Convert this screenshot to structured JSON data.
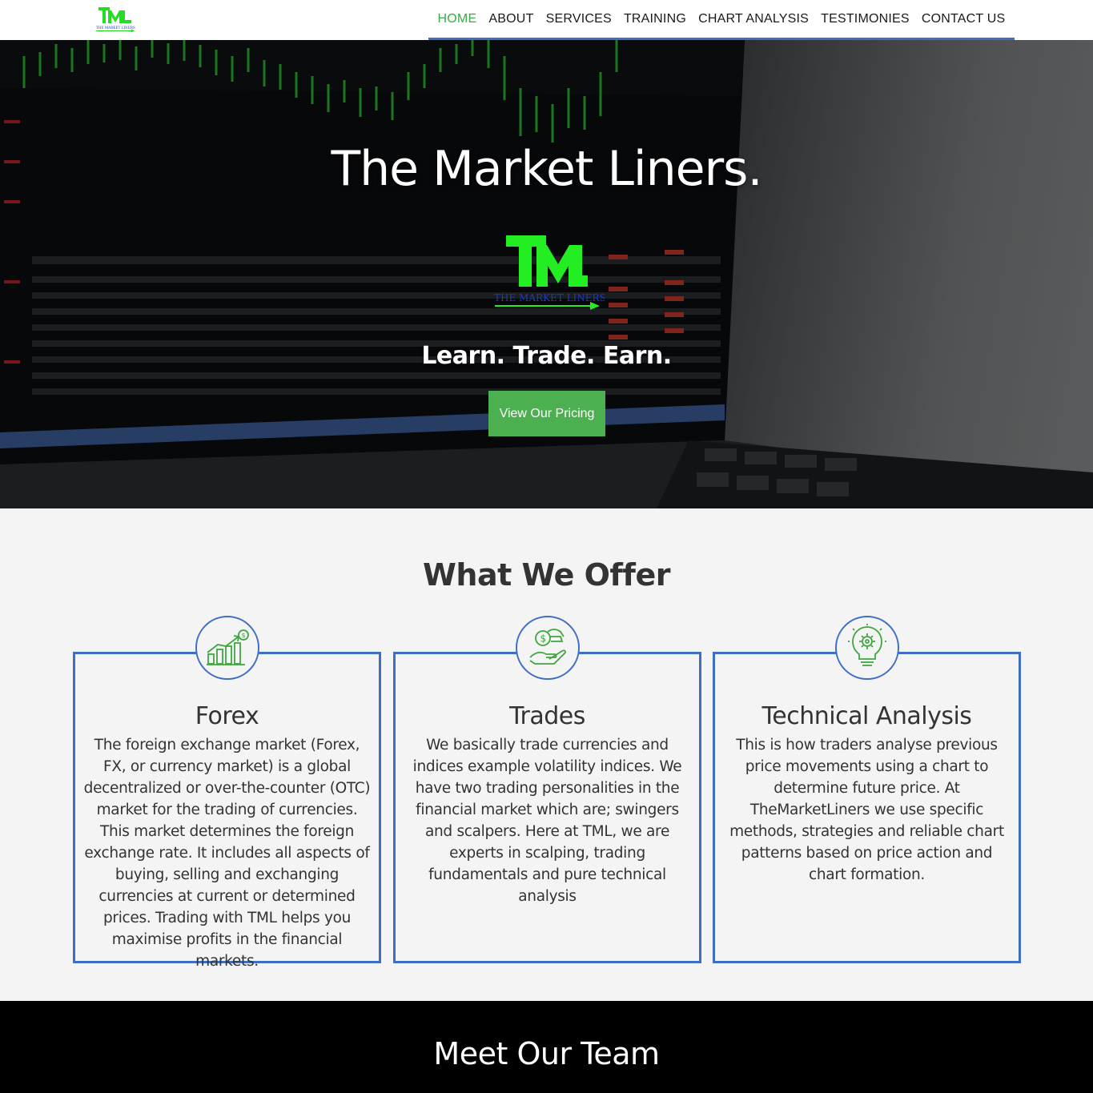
{
  "header": {
    "brand_logo_text": "TML",
    "brand_logo_subtext": "THE MARKET LINERS",
    "nav": [
      {
        "label": "HOME",
        "active": true
      },
      {
        "label": "ABOUT"
      },
      {
        "label": "SERVICES"
      },
      {
        "label": "TRAINING"
      },
      {
        "label": "CHART ANALYSIS"
      },
      {
        "label": "TESTIMONIES"
      },
      {
        "label": "CONTACT US"
      }
    ]
  },
  "hero": {
    "title": "The Market Liners.",
    "logo_text": "TML",
    "logo_subtext": "THE MARKET LINERS",
    "tagline": "Learn. Trade. Earn.",
    "cta_label": "View Our Pricing"
  },
  "offer": {
    "title": "What We Offer",
    "cards": [
      {
        "icon": "growth-chart-icon",
        "title": "Forex",
        "text": "The foreign exchange market (Forex, FX, or currency market) is a global decentralized or over-the-counter (OTC) market for the trading of currencies. This market determines the foreign exchange rate. It includes all aspects of buying, selling and exchanging currencies at current or determined prices. Trading with TML helps you maximise profits in the financial markets."
      },
      {
        "icon": "hand-money-icon",
        "title": "Trades",
        "text": "We basically trade currencies and indices example volatility indices. We have two trading personalities in the financial market which are; swingers and scalpers. Here at TML, we are experts in scalping, trading fundamentals and pure technical analysis"
      },
      {
        "icon": "lightbulb-gear-icon",
        "title": "Technical Analysis",
        "text": "This is how traders analyse previous price movements using a chart to determine future price. At TheMarketLiners we use specific methods, strategies and reliable chart patterns based on price action and chart formation."
      }
    ]
  },
  "team": {
    "title": "Meet Our Team"
  },
  "colors": {
    "accent_green": "#4caf50",
    "logo_green": "#22dd22",
    "border_blue": "#3f6fc5",
    "nav_active": "#3daa48"
  }
}
